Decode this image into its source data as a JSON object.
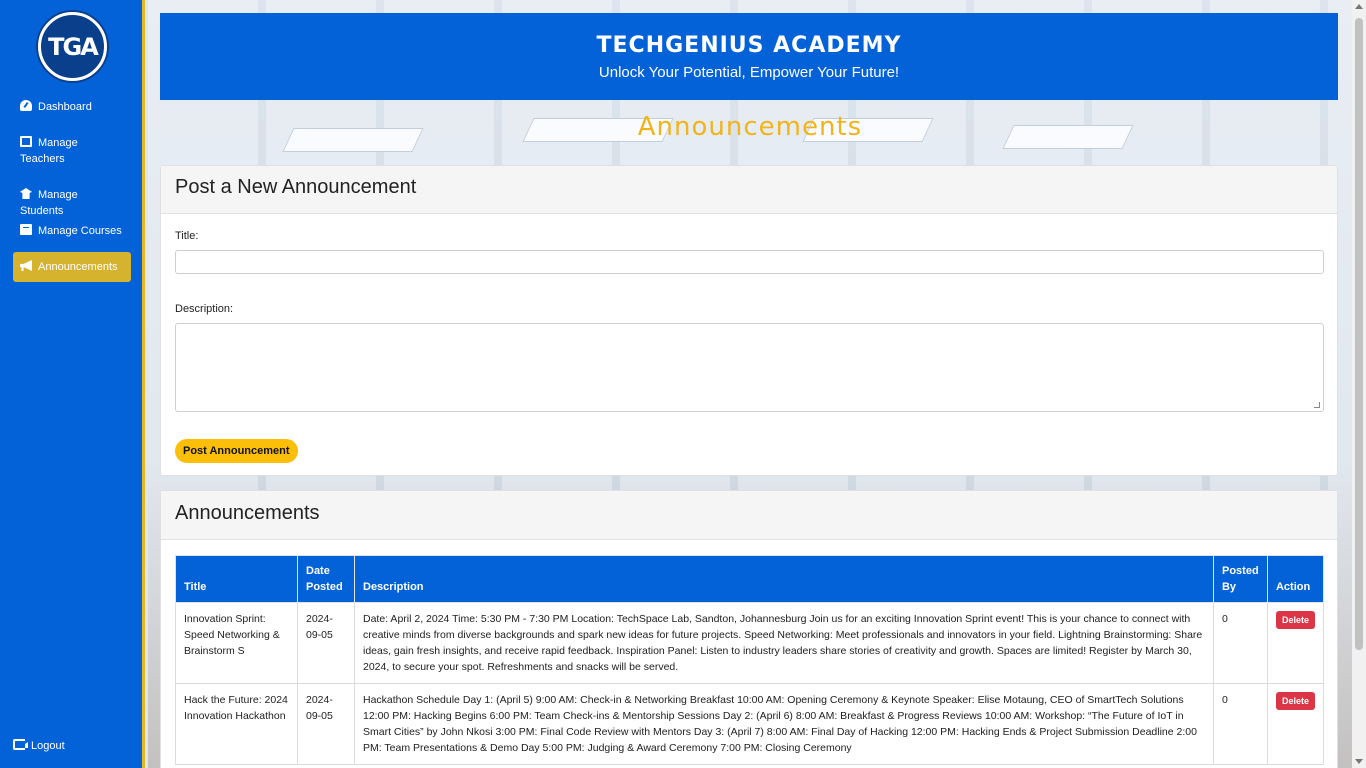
{
  "sidebar": {
    "logo_text": "TGA",
    "items": [
      {
        "label": "Dashboard",
        "icon": "dashboard-icon"
      },
      {
        "label": "Manage Teachers",
        "icon": "chalkboard-teacher-icon"
      },
      {
        "label": "Manage Students",
        "icon": "user-graduate-icon"
      },
      {
        "label": "Manage Courses",
        "icon": "book-icon"
      },
      {
        "label": "Announcements",
        "icon": "bullhorn-icon",
        "active": true
      }
    ],
    "logout_label": "Logout"
  },
  "banner": {
    "title": "TECHGENIUS ACADEMY",
    "subtitle": "Unlock Your Potential, Empower Your Future!"
  },
  "page_heading": "Announcements",
  "post_form": {
    "header": "Post a New Announcement",
    "title_label": "Title:",
    "title_value": "",
    "description_label": "Description:",
    "description_value": "",
    "submit_label": "Post Announcement"
  },
  "announcements": {
    "header": "Announcements",
    "columns": [
      "Title",
      "Date Posted",
      "Description",
      "Posted By",
      "Action"
    ],
    "rows": [
      {
        "title": "Innovation Sprint: Speed Networking & Brainstorm S",
        "date": "2024-09-05",
        "description": "Date: April 2, 2024 Time: 5:30 PM - 7:30 PM Location: TechSpace Lab, Sandton, Johannesburg Join us for an exciting Innovation Sprint event! This is your chance to connect with creative minds from diverse backgrounds and spark new ideas for future projects. Speed Networking: Meet professionals and innovators in your field. Lightning Brainstorming: Share ideas, gain fresh insights, and receive rapid feedback. Inspiration Panel: Listen to industry leaders share stories of creativity and growth. Spaces are limited! Register by March 30, 2024, to secure your spot. Refreshments and snacks will be served.",
        "posted_by": "0",
        "action": "Delete"
      },
      {
        "title": "Hack the Future: 2024 Innovation Hackathon",
        "date": "2024-09-05",
        "description": "Hackathon Schedule Day 1: (April 5) 9:00 AM: Check-in & Networking Breakfast 10:00 AM: Opening Ceremony & Keynote Speaker: Elise Motaung, CEO of SmartTech Solutions 12:00 PM: Hacking Begins 6:00 PM: Team Check-ins & Mentorship Sessions Day 2: (April 6) 8:00 AM: Breakfast & Progress Reviews 10:00 AM: Workshop: “The Future of IoT in Smart Cities” by John Nkosi 3:00 PM: Final Code Review with Mentors Day 3: (April 7) 8:00 AM: Final Day of Hacking 12:00 PM: Hacking Ends & Project Submission Deadline 2:00 PM: Team Presentations & Demo Day 5:00 PM: Judging & Award Ceremony 7:00 PM: Closing Ceremony",
        "posted_by": "0",
        "action": "Delete"
      }
    ]
  },
  "colors": {
    "primary": "#0462d9",
    "accent": "#fbbf0a",
    "active_nav": "#d6b32f",
    "danger": "#dc3545"
  }
}
